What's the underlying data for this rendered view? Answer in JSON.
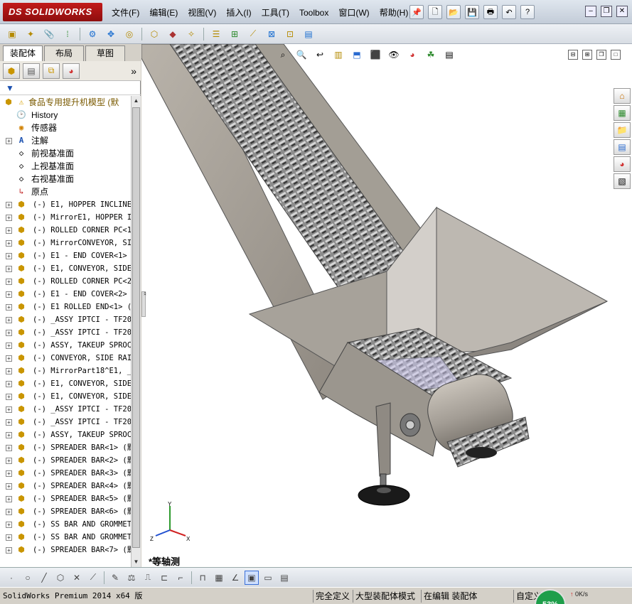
{
  "app": {
    "logo": "DS SOLIDWORKS"
  },
  "menu": {
    "items": [
      "文件(F)",
      "编辑(E)",
      "视图(V)",
      "插入(I)",
      "工具(T)",
      "Toolbox",
      "窗口(W)",
      "帮助(H)"
    ]
  },
  "panel": {
    "tabs": [
      "装配体",
      "布局",
      "草图"
    ],
    "active_tab": "装配体",
    "filter_icon": "filter-icon"
  },
  "tree": {
    "root": "食品专用提升机模型 (默",
    "features": [
      {
        "label": "History",
        "icon": "history-icon"
      },
      {
        "label": "传感器",
        "icon": "sensor-icon"
      },
      {
        "label": "注解",
        "icon": "annotation-icon"
      },
      {
        "label": "前视基准面",
        "icon": "plane-icon"
      },
      {
        "label": "上视基准面",
        "icon": "plane-icon"
      },
      {
        "label": "右视基准面",
        "icon": "plane-icon"
      },
      {
        "label": "原点",
        "icon": "origin-icon"
      }
    ],
    "components": [
      "(-) E1, HOPPER INCLINE",
      "(-) MirrorE1, HOPPER IN",
      "(-) ROLLED CORNER PC<1>",
      "(-) MirrorCONVEYOR, SID",
      "(-) E1 - END COVER<1> (",
      "(-) E1, CONVEYOR, SIDE",
      "(-) ROLLED CORNER PC<2>",
      "(-) E1 - END COVER<2> (",
      "(-) E1 ROLLED END<1> (默",
      "(-) _ASSY IPTCI - TF205",
      "(-) _ASSY IPTCI - TF205",
      "(-) ASSY, TAKEUP SPROCK",
      "(-) CONVEYOR, SIDE RAIL",
      "(-) MirrorPart18^E1, _A",
      "(-) E1, CONVEYOR, SIDE",
      "(-) E1, CONVEYOR, SIDE",
      "(-) _ASSY IPTCI - TF205",
      "(-) _ASSY IPTCI - TF205",
      "(-) ASSY, TAKEUP SPROCK",
      "(-) SPREADER BAR<1> (默",
      "(-) SPREADER BAR<2> (默",
      "(-) SPREADER BAR<3> (默",
      "(-) SPREADER BAR<4> (默",
      "(-) SPREADER BAR<5> (默",
      "(-) SPREADER BAR<6> (默",
      "(-) SS BAR AND GROMMET<",
      "(-) SS BAR AND GROMMET<",
      "(-) SPREADER BAR<7> (默"
    ]
  },
  "viewport": {
    "view_name": "*等轴测",
    "triad": {
      "x": "X",
      "y": "Y",
      "z": "Z"
    }
  },
  "status": {
    "app": "SolidWorks Premium 2014 x64 版",
    "fully_defined": "完全定义",
    "large_assembly": "大型装配体模式",
    "editing": "在编辑 装配体",
    "custom": "自定义",
    "gauge": "53%",
    "net_speed": "0K/s"
  },
  "colors": {
    "logo_red": "#b01616",
    "gauge_green": "#1e9e4a",
    "model_gray": "#9a948c"
  }
}
